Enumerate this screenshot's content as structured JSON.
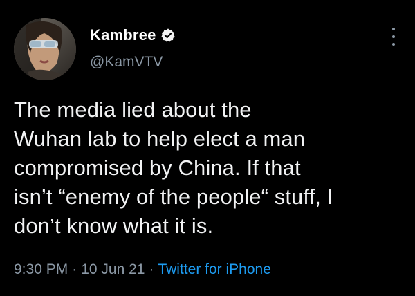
{
  "author": {
    "name": "Kambree",
    "handle": "@KamVTV",
    "verified": true,
    "avatar_icon": "profile-photo"
  },
  "tweet": {
    "text": "The media lied about the\nWuhan lab to help elect a man\ncompromised by China. If that\nisn’t “enemy of the people“ stuff, I\ndon’t know what it is.",
    "time": "9:30 PM",
    "separator": "·",
    "date": "10 Jun 21",
    "source": "Twitter for iPhone"
  },
  "colors": {
    "background": "#000000",
    "text": "#e7e9ea",
    "secondary": "#8b98a5",
    "accent": "#1d9bf0"
  },
  "icons": {
    "verified": "verified-badge-icon",
    "more": "more-options-icon"
  }
}
